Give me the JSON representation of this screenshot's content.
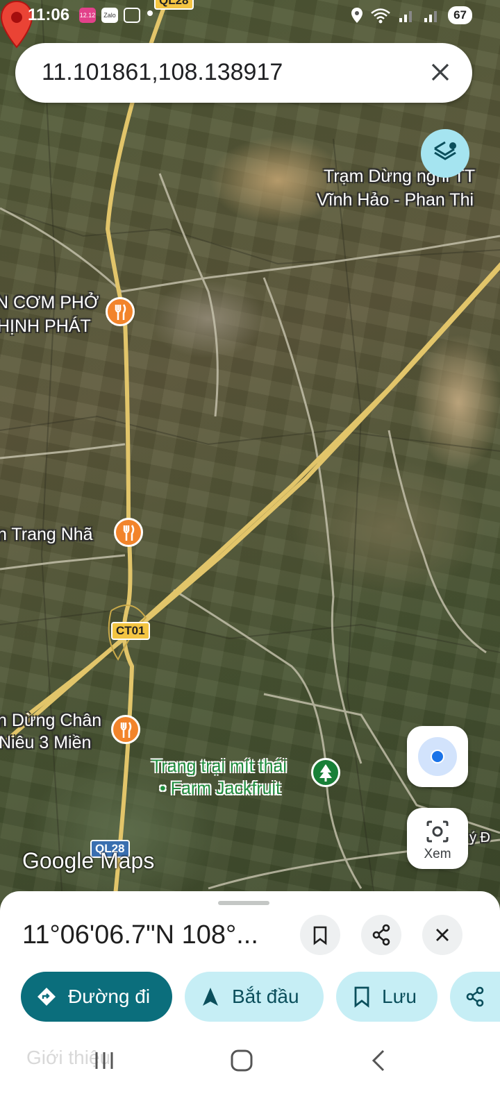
{
  "status_bar": {
    "time": "11:06",
    "notification_apps": [
      "Lazada",
      "Zalo",
      "Screenshot"
    ],
    "battery": "67"
  },
  "search": {
    "query": "11.101861,108.138917",
    "clear_icon": "close-icon"
  },
  "map": {
    "labels": {
      "poi1_line1": "Trạm Dừng nghỉ TT",
      "poi1_line2": "Vĩnh Hảo - Phan Thi",
      "poi2_line1": "N CƠM PHỞ",
      "poi2_line2": "HỊNH PHÁT",
      "poi3": "n Trang Nhã",
      "poi4_line1": "n Dừng Chân",
      "poi4_line2": "Niêu 3 Miền",
      "poi5_line1": "Trang trại mít thái",
      "poi5_line2": "• Farm Jackfruit",
      "edge_label": "ý Đ"
    },
    "road_shields": {
      "top": "QL28",
      "ct01": "CT01",
      "bottom": "QL28"
    },
    "watermark": "Google Maps",
    "lens_label": "Xem",
    "colors": {
      "pin": "#ea4335",
      "restaurant_poi": "#f2842b",
      "park_poi": "#188038",
      "my_location": "#1a73e8"
    }
  },
  "sheet": {
    "coordinates": "11°06'06.7\"N 108°...",
    "actions": {
      "directions": "Đường đi",
      "start": "Bắt đầu",
      "save": "Lưu"
    },
    "colors": {
      "primary": "#0b6e7c",
      "tonal": "#c6eef5"
    }
  },
  "ghost_tab": "Giới thiệu"
}
